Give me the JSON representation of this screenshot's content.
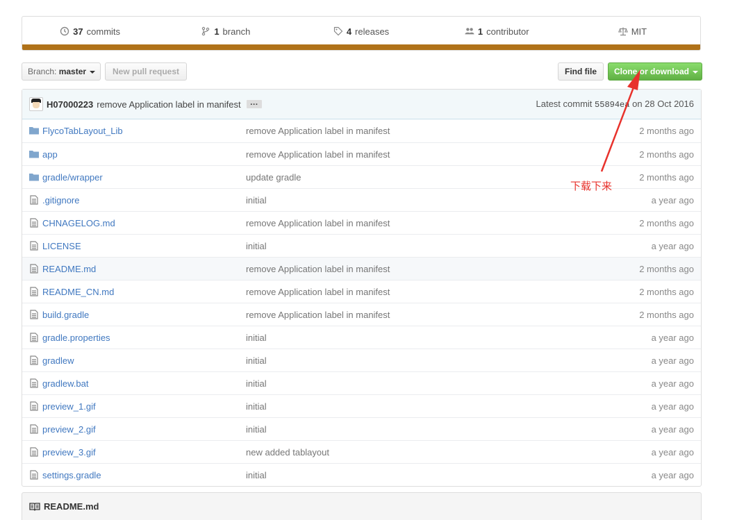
{
  "summary": {
    "commits_count": "37",
    "commits_label": "commits",
    "branch_count": "1",
    "branch_label": "branch",
    "releases_count": "4",
    "releases_label": "releases",
    "contributor_count": "1",
    "contributor_label": "contributor",
    "license": "MIT",
    "lang_color": "#b07219"
  },
  "toolbar": {
    "branch_prefix": "Branch:",
    "branch_name": "master",
    "new_pr": "New pull request",
    "find_file": "Find file",
    "clone": "Clone or download",
    "clone_color": "#60b044"
  },
  "commit": {
    "author": "H07000223",
    "message": "remove Application label in manifest",
    "ellipsis": "…",
    "latest_label": "Latest commit",
    "sha": "55894ea",
    "date": "on 28 Oct 2016"
  },
  "files": [
    {
      "type": "dir",
      "name": "FlycoTabLayout_Lib",
      "message": "remove Application label in manifest",
      "age": "2 months ago"
    },
    {
      "type": "dir",
      "name": "app",
      "message": "remove Application label in manifest",
      "age": "2 months ago"
    },
    {
      "type": "dir",
      "name": "gradle/wrapper",
      "message": "update gradle",
      "age": "2 months ago"
    },
    {
      "type": "file",
      "name": ".gitignore",
      "message": "initial",
      "age": "a year ago"
    },
    {
      "type": "file",
      "name": "CHNAGELOG.md",
      "message": "remove Application label in manifest",
      "age": "2 months ago"
    },
    {
      "type": "file",
      "name": "LICENSE",
      "message": "initial",
      "age": "a year ago"
    },
    {
      "type": "file",
      "name": "README.md",
      "message": "remove Application label in manifest",
      "age": "2 months ago",
      "highlighted": true
    },
    {
      "type": "file",
      "name": "README_CN.md",
      "message": "remove Application label in manifest",
      "age": "2 months ago"
    },
    {
      "type": "file",
      "name": "build.gradle",
      "message": "remove Application label in manifest",
      "age": "2 months ago"
    },
    {
      "type": "file",
      "name": "gradle.properties",
      "message": "initial",
      "age": "a year ago"
    },
    {
      "type": "file",
      "name": "gradlew",
      "message": "initial",
      "age": "a year ago"
    },
    {
      "type": "file",
      "name": "gradlew.bat",
      "message": "initial",
      "age": "a year ago"
    },
    {
      "type": "file",
      "name": "preview_1.gif",
      "message": "initial",
      "age": "a year ago"
    },
    {
      "type": "file",
      "name": "preview_2.gif",
      "message": "initial",
      "age": "a year ago"
    },
    {
      "type": "file",
      "name": "preview_3.gif",
      "message": "new added tablayout",
      "age": "a year ago"
    },
    {
      "type": "file",
      "name": "settings.gradle",
      "message": "initial",
      "age": "a year ago"
    }
  ],
  "readme": {
    "title": "README.md"
  },
  "annotation": {
    "text": "下载下来",
    "color": "#e8322c"
  }
}
